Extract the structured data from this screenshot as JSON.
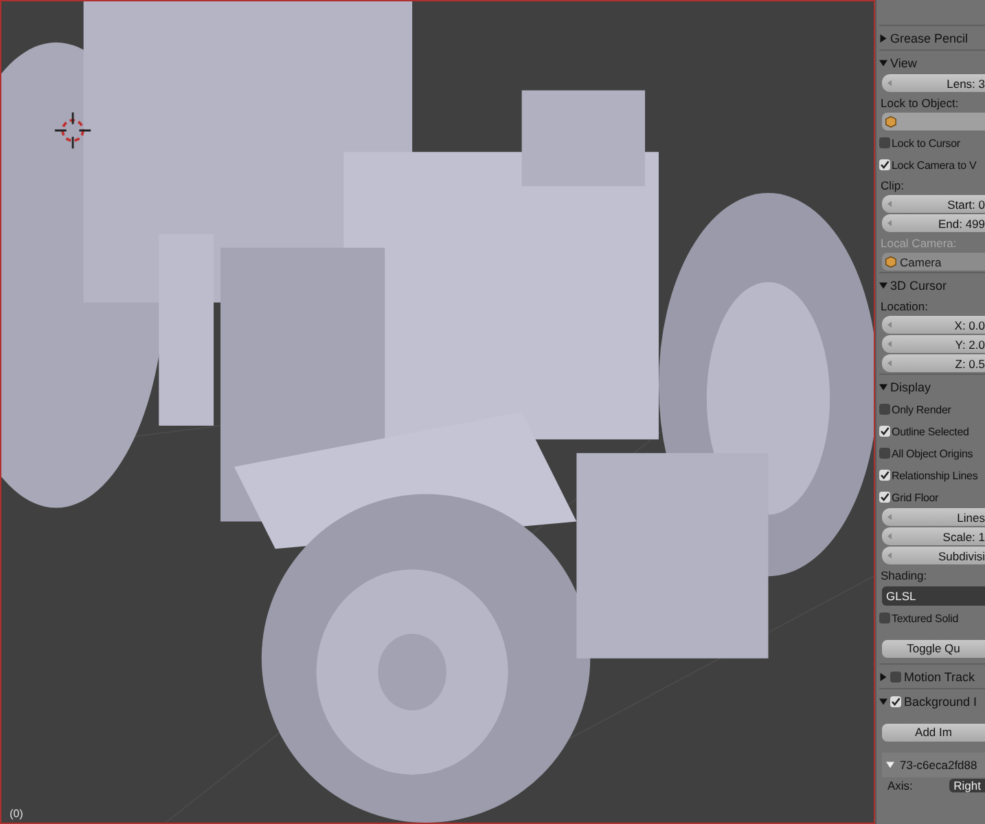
{
  "viewport": {
    "frame_label": "(0)"
  },
  "panel": {
    "rows": [
      {
        "kind": "header",
        "text": "Grease Pencil",
        "expanded": false
      },
      {
        "kind": "header",
        "text": "View",
        "expanded": true
      },
      {
        "kind": "slider",
        "text": "Lens: 3"
      },
      {
        "kind": "label",
        "text": "Lock to Object:",
        "disabled": false
      },
      {
        "kind": "field",
        "text": "",
        "disabled": false
      },
      {
        "kind": "check",
        "text": "Lock to Cursor",
        "checked": false
      },
      {
        "kind": "check",
        "text": "Lock Camera to V",
        "checked": true
      },
      {
        "kind": "label",
        "text": "Clip:",
        "disabled": false
      },
      {
        "kind": "slider",
        "text": "Start: 0"
      },
      {
        "kind": "slider",
        "text": "End: 499"
      },
      {
        "kind": "label",
        "text": "Local Camera:",
        "disabled": true
      },
      {
        "kind": "field",
        "text": "Camera",
        "disabled": true
      },
      {
        "kind": "header",
        "text": "3D Cursor",
        "expanded": true
      },
      {
        "kind": "label",
        "text": "Location:",
        "disabled": false
      },
      {
        "kind": "slider",
        "text": "X: 0.0"
      },
      {
        "kind": "slider",
        "text": "Y: 2.0"
      },
      {
        "kind": "slider",
        "text": "Z: 0.5"
      },
      {
        "kind": "header",
        "text": "Display",
        "expanded": true
      },
      {
        "kind": "check",
        "text": "Only Render",
        "checked": false
      },
      {
        "kind": "check",
        "text": "Outline Selected",
        "checked": true
      },
      {
        "kind": "check",
        "text": "All Object Origins",
        "checked": false
      },
      {
        "kind": "check",
        "text": "Relationship Lines",
        "checked": true
      },
      {
        "kind": "check",
        "text": "Grid Floor",
        "checked": true
      },
      {
        "kind": "slider",
        "text": "Lines"
      },
      {
        "kind": "slider",
        "text": "Scale: 1"
      },
      {
        "kind": "slider",
        "text": "Subdivisi"
      },
      {
        "kind": "label",
        "text": "Shading:",
        "disabled": false
      },
      {
        "kind": "dropdown",
        "text": "GLSL"
      },
      {
        "kind": "check",
        "text": "Textured Solid",
        "checked": false
      },
      {
        "kind": "button",
        "text": "Toggle Qu"
      },
      {
        "kind": "header",
        "text": "Motion Track",
        "expanded": false,
        "checked": false
      },
      {
        "kind": "header",
        "text": "Background I",
        "expanded": true,
        "checked": true
      },
      {
        "kind": "button",
        "text": "Add Im"
      },
      {
        "kind": "subitem",
        "text": "73-c6eca2fd88",
        "expanded": true
      },
      {
        "kind": "axis",
        "text": "Axis:",
        "value": "Right"
      }
    ]
  }
}
